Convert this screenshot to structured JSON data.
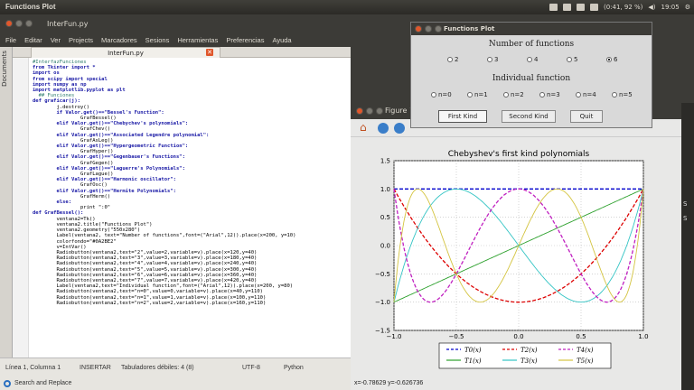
{
  "topbar": {
    "app_title": "Functions Plot",
    "battery": "(0:41, 92 %)",
    "clock": "19:05"
  },
  "editor": {
    "window_title": "InterFun.py",
    "menu": [
      "File",
      "Editar",
      "Ver",
      "Projects",
      "Marcadores",
      "Sesions",
      "Herramientas",
      "Preferencias",
      "Ayuda"
    ],
    "sidebar_label": "Documents",
    "tab_label": "InterFun.py",
    "code_lines": [
      "#InterfazFunciones",
      "from Tkinter import *",
      "import os",
      "from scipy import special",
      "import numpy as np",
      "import matplotlib.pyplot as plt",
      "",
      "  ## Funciones",
      "",
      "def graficar(j):",
      "        j.destroy()",
      "        if Valor.get()==\"Bessel's Function\":",
      "                GrafBessel()",
      "        elif Valor.get()==\"Chebychev's polynomials\":",
      "                GrafChev()",
      "        elif Valor.get()==\"Associated Legendre polynomial\":",
      "                GrafAsLeg()",
      "        elif Valor.get()==\"Hypergeometric Function\":",
      "                GrafHyper()",
      "        elif Valor.get()==\"Gegenbauer's Functions\":",
      "                GrafGegen()",
      "        elif Valor.get()==\"Laguerre's Polynomials\":",
      "                GrafLague()",
      "        elif Valor.get()==\"Harmonic oscillator\":",
      "                GrafOsc()",
      "        elif Valor.get()==\"Hermite Polynomials\":",
      "                GrafHerm()",
      "        else:",
      "                print \":0\"",
      "def GrafBessel():",
      "        ventana2=Tk()",
      "        ventana2.title(\"Functions Plot\")",
      "        ventana2.geometry(\"550x280\")",
      "        Label(ventana2, text=\"Number of functions\",font=(\"Arial\",12)).place(x=200, y=10)",
      "        colorfondo=\"#0A2BE2\"",
      "        v=IntVar()",
      "        Radiobutton(ventana2,text=\"2\",value=2,variable=v).place(x=120,y=40)",
      "        Radiobutton(ventana2,text=\"3\",value=3,variable=v).place(x=180,y=40)",
      "        Radiobutton(ventana2,text=\"4\",value=4,variable=v).place(x=240,y=40)",
      "        Radiobutton(ventana2,text=\"5\",value=5,variable=v).place(x=300,y=40)",
      "        Radiobutton(ventana2,text=\"6\",value=6,variable=v).place(x=360,y=40)",
      "        Radiobutton(ventana2,text=\"7\",value=7,variable=v).place(x=420,y=40)",
      "        Label(ventana2,text=\"Individual function\",font=(\"Arial\",12)).place(x=200, y=80)",
      "        Radiobutton(ventana2,text=\"n=0\",value=0,variable=v).place(x=40,y=110)",
      "        Radiobutton(ventana2,text=\"n=1\",value=1,variable=v).place(x=100,y=110)",
      "        Radiobutton(ventana2,text=\"n=2\",value=2,variable=v).place(x=160,y=110)"
    ],
    "status": {
      "position": "Línea 1, Columna 1",
      "mode": "INSERTAR",
      "tabs": "Tabuladores débiles: 4 (8)",
      "encoding": "UTF-8",
      "language": "Python"
    },
    "search_label": "Search and Replace"
  },
  "dialog": {
    "title": "Functions Plot",
    "number_label": "Number of functions",
    "number_options": [
      "2",
      "3",
      "4",
      "5",
      "6"
    ],
    "number_selected": "6",
    "individual_label": "Individual function",
    "individual_options": [
      "n=0",
      "n=1",
      "n=2",
      "n=3",
      "n=4",
      "n=5"
    ],
    "buttons": {
      "first": "First Kind",
      "second": "Second Kind",
      "quit": "Quit"
    }
  },
  "figure": {
    "window_title": "Figure 1",
    "status": "x=-0.78629    y=-0.626736",
    "right_fragment": [
      "S",
      "S"
    ]
  },
  "chart_data": {
    "type": "line",
    "title": "Chebyshev's first kind polynomials",
    "xlabel": "",
    "ylabel": "",
    "xlim": [
      -1.0,
      1.0
    ],
    "ylim": [
      -1.5,
      1.5
    ],
    "xticks": [
      "−1.0",
      "−0.5",
      "0.0",
      "0.5",
      "1.0"
    ],
    "yticks": [
      "1.5",
      "1.0",
      "0.5",
      "0.0",
      "−0.5",
      "−1.0",
      "−1.5"
    ],
    "grid": true,
    "legend_placement": "bottom",
    "series": [
      {
        "name": "T0(x)",
        "degree": 0,
        "color": "#0000cc",
        "style": "dashed"
      },
      {
        "name": "T1(x)",
        "degree": 1,
        "color": "#2ca02c",
        "style": "solid"
      },
      {
        "name": "T2(x)",
        "degree": 2,
        "color": "#dd0000",
        "style": "dashed"
      },
      {
        "name": "T3(x)",
        "degree": 3,
        "color": "#33c4c4",
        "style": "solid"
      },
      {
        "name": "T4(x)",
        "degree": 4,
        "color": "#c020c0",
        "style": "dashed"
      },
      {
        "name": "T5(x)",
        "degree": 5,
        "color": "#d4c440",
        "style": "solid"
      }
    ]
  }
}
